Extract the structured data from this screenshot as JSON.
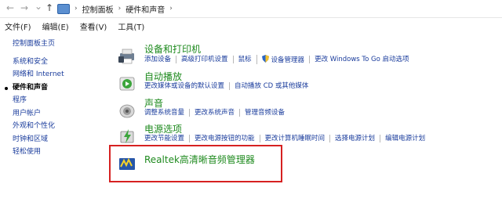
{
  "address_bar": {
    "back_icon": "←",
    "forward_icon": "→",
    "dropdown_icon": "⌄",
    "up_icon": "↑",
    "crumbs": [
      "控制面板",
      "硬件和声音"
    ]
  },
  "menu": [
    "文件(F)",
    "编辑(E)",
    "查看(V)",
    "工具(T)"
  ],
  "sidebar": {
    "items": [
      "控制面板主页",
      "系统和安全",
      "网络和 Internet",
      "硬件和声音",
      "程序",
      "用户帐户",
      "外观和个性化",
      "时钟和区域",
      "轻松使用"
    ],
    "active_index": 3
  },
  "categories": [
    {
      "title": "设备和打印机",
      "icon": "printer-icon",
      "links": [
        "添加设备",
        "高级打印机设置",
        "鼠标",
        "设备管理器",
        "更改 Windows To Go 启动选项"
      ]
    },
    {
      "title": "自动播放",
      "icon": "autoplay-icon",
      "links": [
        "更改媒体或设备的默认设置",
        "自动播放 CD 或其他媒体"
      ]
    },
    {
      "title": "声音",
      "icon": "speaker-icon",
      "links": [
        "调整系统音量",
        "更改系统声音",
        "管理音频设备"
      ]
    },
    {
      "title": "电源选项",
      "icon": "power-icon",
      "links": [
        "更改节能设置",
        "更改电源按钮的功能",
        "更改计算机睡眠时间",
        "选择电源计划",
        "编辑电源计划"
      ]
    },
    {
      "title": "Realtek高清晰音频管理器",
      "icon": "realtek-icon",
      "links": []
    }
  ],
  "colors": {
    "category_title": "#1e8a1e",
    "link": "#1a3c9c",
    "highlight": "#d62121"
  }
}
